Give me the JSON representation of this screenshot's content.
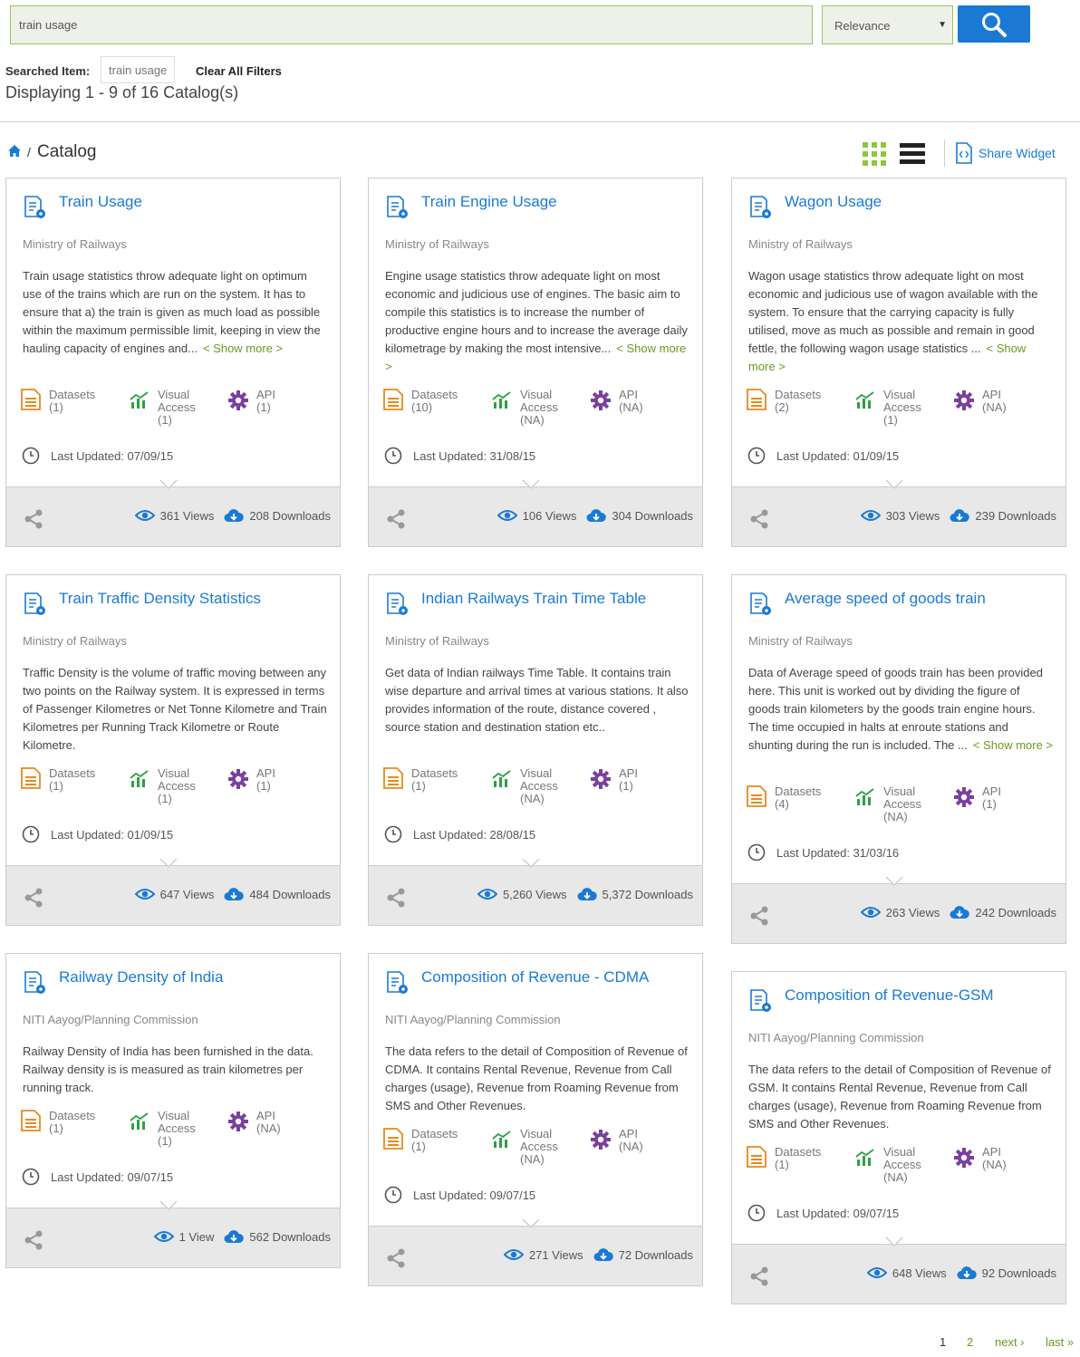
{
  "search": {
    "value": "train usage",
    "sort_selected": "Relevance"
  },
  "filters": {
    "searched_label": "Searched Item:",
    "searched_chip": "train usage",
    "clear_all": "Clear All Filters",
    "displaying": "Displaying 1 - 9 of 16 Catalog(s)"
  },
  "breadcrumb": {
    "sep": "/",
    "title": "Catalog"
  },
  "toolbar": {
    "share_widget": "Share Widget"
  },
  "labels": {
    "datasets": "Datasets",
    "visual": "Visual",
    "access": "Access",
    "api": "API"
  },
  "cards": [
    {
      "title": "Train Usage",
      "org": "Ministry of Railways",
      "desc": "Train usage statistics throw adequate light on optimum use of the trains which are run on the system. It has to ensure that a) the train is given as much load as possible within the maximum permissible limit, keeping in view the hauling capacity of engines and...",
      "show_more": "< Show more >",
      "datasets": "(1)",
      "visual": "(1)",
      "api": "(1)",
      "updated": "Last Updated: 07/09/15",
      "views": "361 Views",
      "downloads": "208 Downloads"
    },
    {
      "title": "Train Engine Usage",
      "org": "Ministry of Railways",
      "desc": "Engine usage statistics throw adequate light on most economic and judicious use of engines. The basic aim to compile this statistics is to increase the number of productive engine hours and to increase the average daily kilometrage by making the most intensive...",
      "show_more": "< Show more >",
      "datasets": "(10)",
      "visual": "(NA)",
      "api": "(NA)",
      "updated": "Last Updated: 31/08/15",
      "views": "106 Views",
      "downloads": "304 Downloads"
    },
    {
      "title": "Wagon Usage",
      "org": "Ministry of Railways",
      "desc": "Wagon usage statistics throw adequate light on most economic and judicious use of wagon available with the system. To ensure that the carrying capacity is fully utilised, move as much as possible and remain in good fettle, the following wagon usage statistics ...",
      "show_more": "< Show more >",
      "datasets": "(2)",
      "visual": "(1)",
      "api": "(NA)",
      "updated": "Last Updated: 01/09/15",
      "views": "303 Views",
      "downloads": "239 Downloads"
    },
    {
      "title": "Train Traffic Density Statistics",
      "org": "Ministry of Railways",
      "desc": "Traffic Density is the volume of traffic moving between any two points on the Railway system. It is expressed in terms of Passenger Kilometres or Net Tonne Kilometre and Train Kilometres per Running Track Kilometre or Route Kilometre.",
      "show_more": "",
      "datasets": "(1)",
      "visual": "(1)",
      "api": "(1)",
      "updated": "Last Updated: 01/09/15",
      "views": "647 Views",
      "downloads": "484 Downloads"
    },
    {
      "title": "Indian Railways Train Time Table",
      "org": "Ministry of Railways",
      "desc": "Get data of Indian railways Time Table. It contains train wise departure and arrival times at various stations. It also provides information of the route, distance covered , source station and destination station etc..",
      "show_more": "",
      "datasets": "(1)",
      "visual": "(NA)",
      "api": "(1)",
      "updated": "Last Updated: 28/08/15",
      "views": "5,260 Views",
      "downloads": "5,372 Downloads"
    },
    {
      "title": "Average speed of goods train",
      "org": "Ministry of Railways",
      "desc": "Data of Average speed of goods train has been provided here. This unit is worked out by dividing the figure of goods train kilometers by the goods train engine hours. The time occupied in halts at enroute stations and shunting during the run is included. The ...",
      "show_more": "< Show more >",
      "datasets": "(4)",
      "visual": "(NA)",
      "api": "(1)",
      "updated": "Last Updated: 31/03/16",
      "views": "263 Views",
      "downloads": "242 Downloads"
    },
    {
      "title": "Railway Density of India",
      "org": "NITI Aayog/Planning Commission",
      "desc": "Railway Density of India has been furnished in the data. Railway density is is measured as train kilometres per running track.",
      "show_more": "",
      "datasets": "(1)",
      "visual": "(1)",
      "api": "(NA)",
      "updated": "Last Updated: 09/07/15",
      "views": "1 View",
      "downloads": "562 Downloads"
    },
    {
      "title": "Composition of Revenue - CDMA",
      "org": "NITI Aayog/Planning Commission",
      "desc": "The data refers to the detail of Composition of Revenue of CDMA. It contains Rental Revenue, Revenue from Call charges (usage), Revenue from Roaming Revenue from SMS and Other Revenues.",
      "show_more": "",
      "datasets": "(1)",
      "visual": "(NA)",
      "api": "(NA)",
      "updated": "Last Updated: 09/07/15",
      "views": "271 Views",
      "downloads": "72 Downloads"
    },
    {
      "title": "Composition of Revenue-GSM",
      "org": "NITI Aayog/Planning Commission",
      "desc": "The data refers to the detail of Composition of Revenue of GSM. It contains Rental Revenue, Revenue from Call charges (usage), Revenue from Roaming Revenue from SMS and Other Revenues.",
      "show_more": "",
      "datasets": "(1)",
      "visual": "(NA)",
      "api": "(NA)",
      "updated": "Last Updated: 09/07/15",
      "views": "648 Views",
      "downloads": "92 Downloads"
    }
  ],
  "pagination": {
    "current": "1",
    "page2": "2",
    "next": "next ›",
    "last": "last »"
  },
  "colors": {
    "accent": "#1a7ad3",
    "show_more": "#6b9a20",
    "datasets_icon": "#e8891c",
    "visual_icon": "#2ea043",
    "api_icon": "#7b3f9e"
  }
}
